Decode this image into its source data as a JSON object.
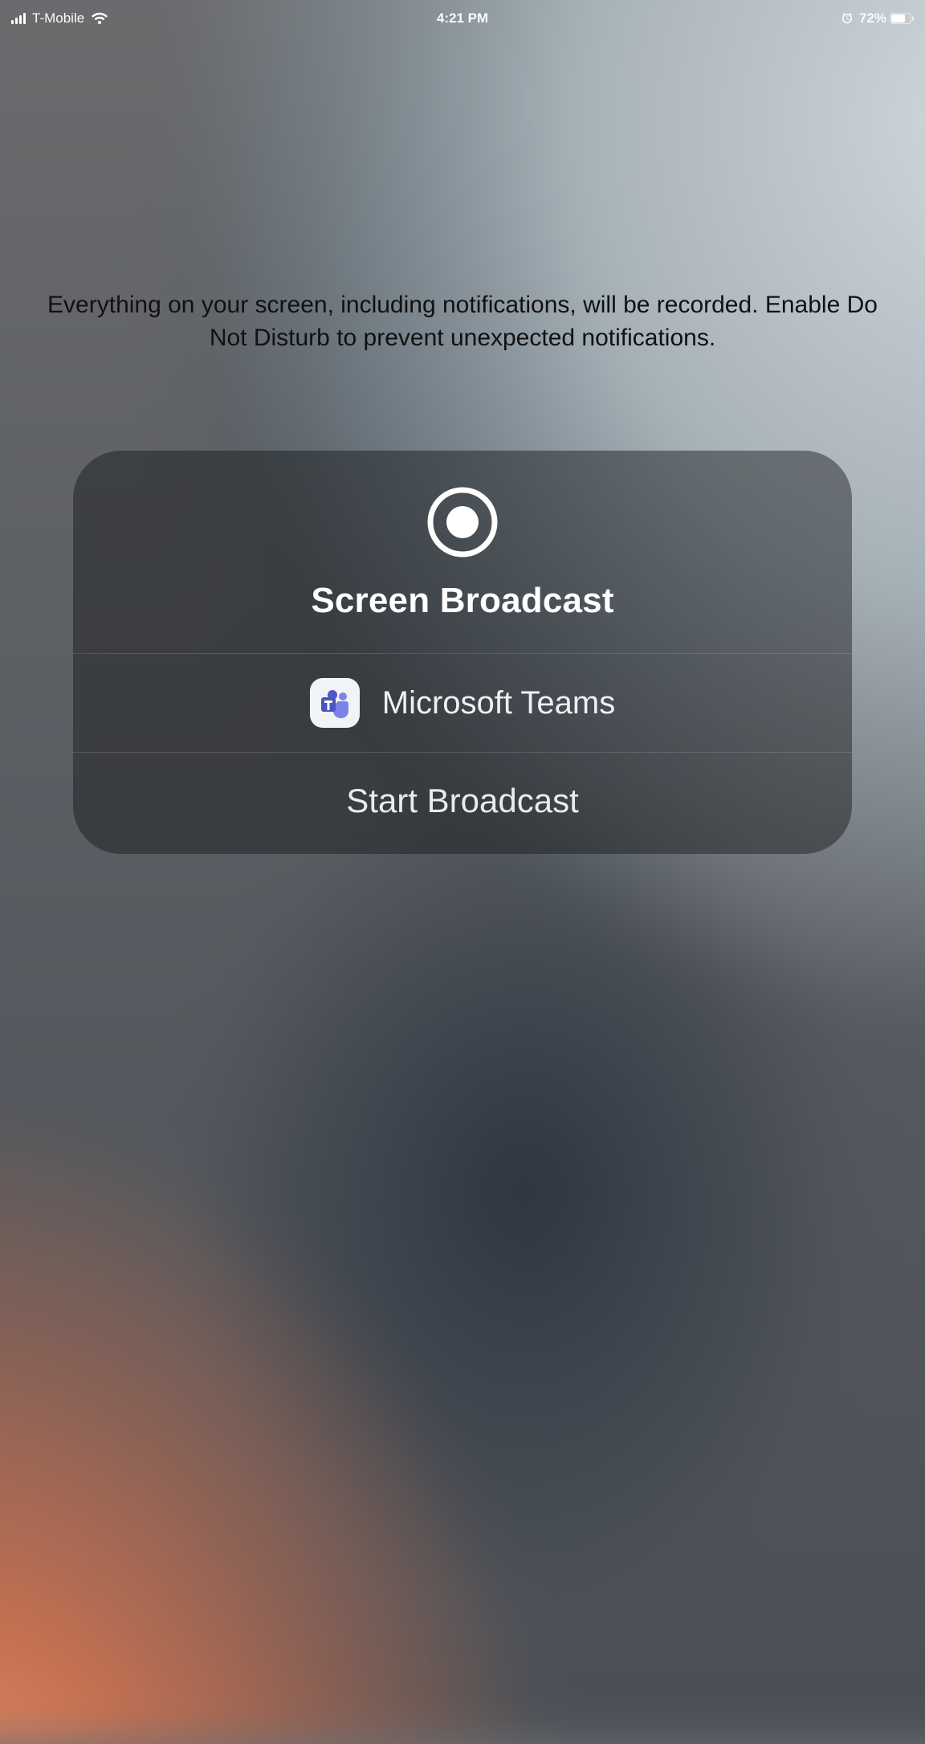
{
  "status_bar": {
    "carrier": "T-Mobile",
    "time": "4:21 PM",
    "battery_percent": "72%"
  },
  "prompt": {
    "text": "Everything on your screen, including notifications, will be recorded. Enable Do Not Disturb to prevent unexpected notifications."
  },
  "broadcast_card": {
    "title": "Screen Broadcast",
    "selected_app": "Microsoft Teams",
    "action_label": "Start Broadcast"
  }
}
